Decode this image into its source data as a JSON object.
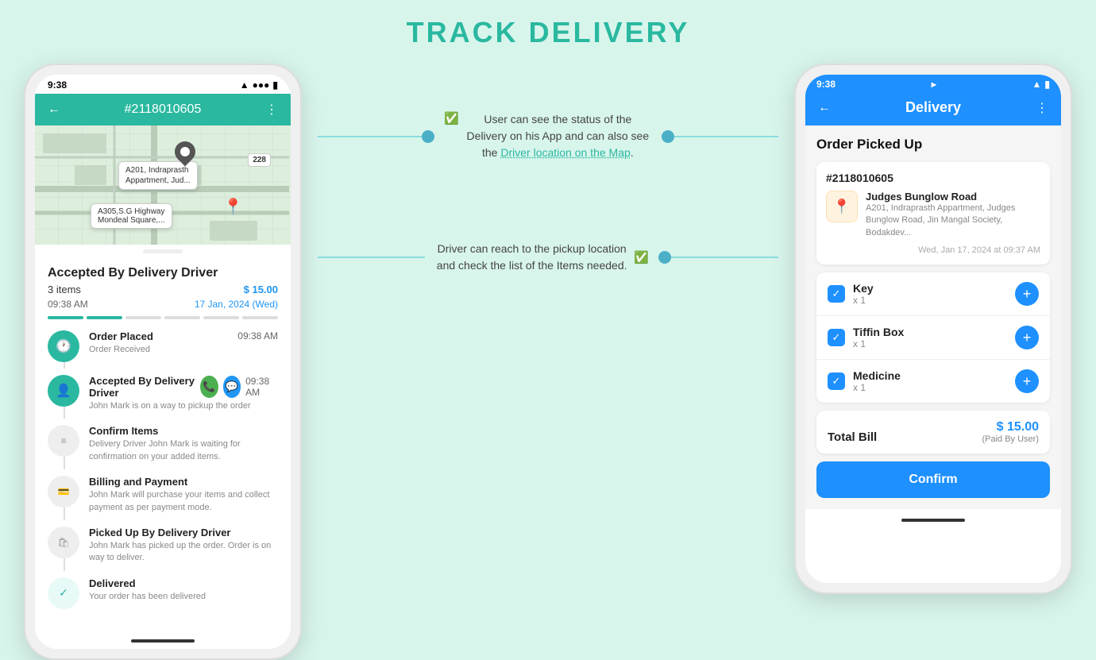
{
  "page": {
    "title": "TRACK DELIVERY",
    "bg_color": "#d8f5ec"
  },
  "phone1": {
    "status_bar": {
      "time": "9:38",
      "wifi": "wifi",
      "battery": "battery"
    },
    "header": {
      "order_id": "#2118010605",
      "back_icon": "←",
      "more_icon": "⋮"
    },
    "map": {
      "label1_line1": "A201, Indraprasth",
      "label1_line2": "Appartment, Jud...",
      "label2_line1": "A305,S.G Highway",
      "label2_line2": "Mondeal Square,...",
      "badge": "228"
    },
    "order": {
      "title": "Accepted By Delivery Driver",
      "items_count": "3 items",
      "price": "$ 15.00",
      "time": "09:38 AM",
      "date": "17 Jan, 2024 (Wed)"
    },
    "timeline": [
      {
        "id": "order-placed",
        "icon": "🕐",
        "title": "Order Placed",
        "time": "09:38 AM",
        "desc": "Order Received",
        "active": true,
        "actions": []
      },
      {
        "id": "accepted-by-driver",
        "icon": "👤",
        "title": "Accepted By Delivery Driver",
        "time": "09:38 AM",
        "desc": "John Mark is on a way to pickup the order",
        "active": true,
        "actions": [
          "phone",
          "chat"
        ]
      },
      {
        "id": "confirm-items",
        "icon": "📋",
        "title": "Confirm Items",
        "time": "",
        "desc": "Delivery Driver John Mark is waiting for confirmation on your added items.",
        "active": false,
        "actions": []
      },
      {
        "id": "billing-payment",
        "icon": "💳",
        "title": "Billing and Payment",
        "time": "",
        "desc": "John Mark will purchase your items and collect payment as per payment mode.",
        "active": false,
        "actions": []
      },
      {
        "id": "picked-up",
        "icon": "🛍",
        "title": "Picked Up By Delivery Driver",
        "time": "",
        "desc": "John Mark has picked up the order. Order is on way to deliver.",
        "active": false,
        "actions": []
      },
      {
        "id": "delivered",
        "icon": "✓",
        "title": "Delivered",
        "time": "",
        "desc": "Your order has been delivered",
        "active": false,
        "actions": []
      }
    ]
  },
  "phone2": {
    "status_bar": {
      "time": "9:38",
      "location_icon": "◂",
      "wifi": "wifi",
      "battery": "battery"
    },
    "header": {
      "title": "Delivery",
      "back_icon": "←",
      "more_icon": "⋮"
    },
    "section_title": "Order Picked Up",
    "order_card": {
      "order_id": "#2118010605",
      "location_name": "Judges Bunglow Road",
      "location_address": "A201, Indraprasth Appartment, Judges Bunglow Road, Jin Mangal Society, Bodakdev...",
      "timestamp": "Wed, Jan 17, 2024 at 09:37 AM",
      "pin_icon": "📍"
    },
    "items": [
      {
        "name": "Key",
        "qty": "x 1",
        "checked": true
      },
      {
        "name": "Tiffin Box",
        "qty": "x 1",
        "checked": true
      },
      {
        "name": "Medicine",
        "qty": "x 1",
        "checked": true
      }
    ],
    "total_bill": {
      "label": "Total Bill",
      "amount": "$ 15.00",
      "paid_by": "(Paid By User)"
    },
    "confirm_button": "Confirm"
  },
  "annotations": [
    {
      "id": "ann-1",
      "text_part1": "User can see the status of the Delivery on his App and can also see the",
      "text_highlight": "Driver location on the Map",
      "text_part2": ".",
      "icon": "check-circle"
    },
    {
      "id": "ann-2",
      "text_part1": "Driver can reach to the pickup location and check the list of the Items",
      "text_highlight": "",
      "text_part2": " needed.",
      "icon": "check-circle"
    }
  ]
}
